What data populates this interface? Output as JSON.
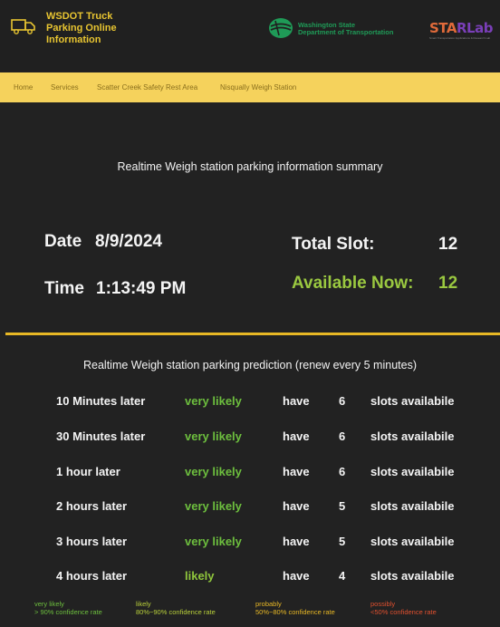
{
  "header": {
    "site_title": "WSDOT Truck Parking Online Information",
    "wsdot_line1": "Washington State",
    "wsdot_line2": "Department of Transportation",
    "star_part1": "ST",
    "star_part2": "A",
    "star_part3": "R",
    "star_part4": "Lab",
    "star_subtitle": "Smart Transportation Applications & Research Lab"
  },
  "nav": {
    "items": [
      "Home",
      "Services",
      "Scatter Creek Safety Rest Area",
      "Nisqually Weigh Station"
    ]
  },
  "summary": {
    "title": "Realtime Weigh station parking information summary",
    "date_label": "Date",
    "date_value": "8/9/2024",
    "time_label": "Time",
    "time_value": "1:13:49 PM",
    "total_label": "Total Slot:",
    "total_value": "12",
    "available_label": "Available Now:",
    "available_value": "12"
  },
  "prediction": {
    "title": "Realtime Weigh station parking prediction (renew every 5 minutes)",
    "rows": [
      {
        "when": "10 Minutes later",
        "likelihood": "very likely",
        "have": "have",
        "slots": "6",
        "suffix": "slots availabile"
      },
      {
        "when": "30 Minutes later",
        "likelihood": "very likely",
        "have": "have",
        "slots": "6",
        "suffix": "slots availabile"
      },
      {
        "when": "1 hour later",
        "likelihood": "very likely",
        "have": "have",
        "slots": "6",
        "suffix": "slots availabile"
      },
      {
        "when": "2 hours later",
        "likelihood": "very likely",
        "have": "have",
        "slots": "5",
        "suffix": "slots availabile"
      },
      {
        "when": "3 hours later",
        "likelihood": "very likely",
        "have": "have",
        "slots": "5",
        "suffix": "slots availabile"
      },
      {
        "when": "4 hours later",
        "likelihood": "likely",
        "have": "have",
        "slots": "4",
        "suffix": "slots availabile"
      }
    ]
  },
  "legend": [
    {
      "term": "very likely",
      "desc": "> 90% confidence rate",
      "color": "#6dbf3e"
    },
    {
      "term": "likely",
      "desc": "80%~90% confidence rate",
      "color": "#b8cf3a"
    },
    {
      "term": "probably",
      "desc": "50%~80% confidence rate",
      "color": "#e8b825"
    },
    {
      "term": "possibly",
      "desc": "<50% confidence rate",
      "color": "#e0502f"
    }
  ],
  "colors": {
    "accent_gold": "#e8b825",
    "nav_bg": "#f5d25c",
    "available_green": "#9ac840",
    "likely_green": "#6dbf3e",
    "wsdot_green": "#1f9a57"
  }
}
